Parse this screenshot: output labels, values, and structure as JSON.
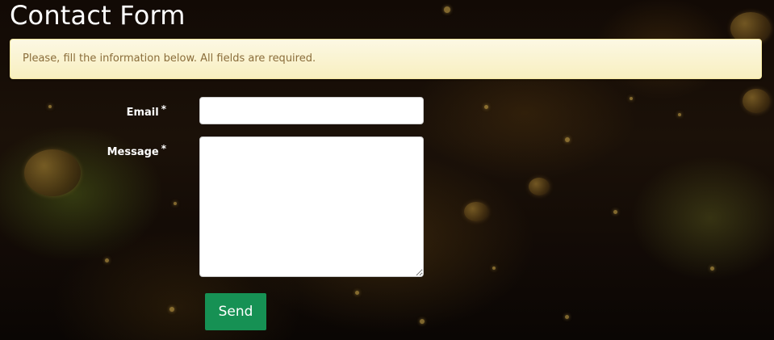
{
  "page": {
    "title": "Contact Form"
  },
  "notice": {
    "text": "Please, fill the information below. All fields are required."
  },
  "form": {
    "email": {
      "label": "Email",
      "required_mark": "*",
      "value": ""
    },
    "message": {
      "label": "Message",
      "required_mark": "*",
      "value": ""
    },
    "send_label": "Send"
  },
  "colors": {
    "notice_background": "#fcf8e3",
    "notice_text": "#8a6d3b",
    "send_button": "#169154",
    "title_text": "#ffffff"
  }
}
